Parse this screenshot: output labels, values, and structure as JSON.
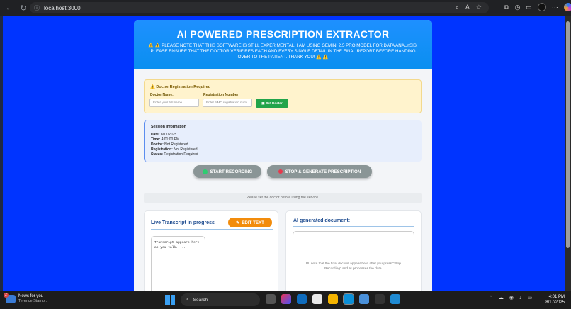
{
  "browser": {
    "url": "localhost:3000"
  },
  "header": {
    "title": "AI POWERED PRESCRIPTION EXTRACTOR",
    "warning": "⚠️ ⚠️ PLEASE NOTE THAT THIS SOFTWARE IS STILL EXPERIMENTAL. I AM USING GEMINI 2.5 PRO MODEL FOR DATA ANALYSIS. PLEASE ENSURE THAT THE DOCTOR VERIFIRES EACH AND EVERY SINGLE DETAIL IN THE FINAL REPORT BEFORE HANDING OVER TO THE PATIENT. THANK YOU! ⚠️ ⚠️"
  },
  "registration": {
    "title": "⚠️ Doctor Registration Required",
    "name_label": "Doctor Name:",
    "name_placeholder": "Enter your full name",
    "reg_label": "Registration Number:",
    "reg_placeholder": "Enter NMC registration num",
    "set_button": "Set Doctor"
  },
  "session": {
    "title": "Session Information",
    "rows": [
      {
        "label": "Date:",
        "value": "8/17/2025"
      },
      {
        "label": "Time:",
        "value": "4:01:00 PM"
      },
      {
        "label": "Doctor:",
        "value": "Not Registered"
      },
      {
        "label": "Registration:",
        "value": "Not Registered"
      },
      {
        "label": "Status:",
        "value": "Registration Required"
      }
    ]
  },
  "controls": {
    "start_label": "START RECORDING",
    "stop_label": "STOP & GENERATE PRESCRIPTION",
    "notice": "Please set the doctor before using the service."
  },
  "transcript": {
    "title": "Live Transcript in progress",
    "edit_label": "EDIT TEXT",
    "placeholder": "Transcript appears here as you talk....."
  },
  "document": {
    "title": "AI generated document:",
    "placeholder": "Pl. note that the final doc will appear here after you press \"Stop Recording\" and AI processes the data."
  },
  "taskbar": {
    "news_title": "News for you",
    "news_sub": "Terence Stamp...",
    "news_badge": "2",
    "search_label": "Search",
    "time": "4:01 PM",
    "date": "8/17/2025"
  },
  "colors": {
    "page_bg": "#0034ff",
    "header_bg": "#1e90ff",
    "green": "#21a44a",
    "orange": "#f28c0c"
  }
}
